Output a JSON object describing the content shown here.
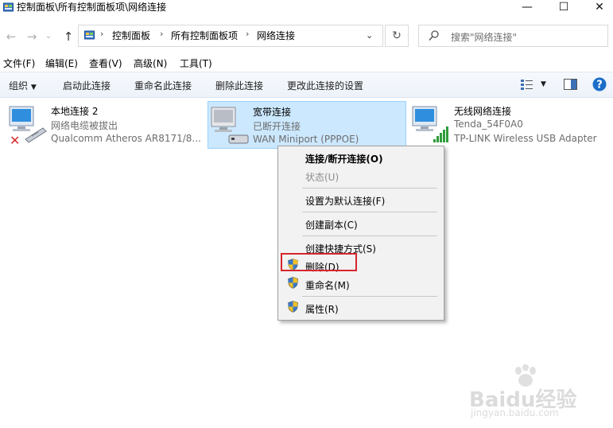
{
  "window": {
    "title": "控制面板\\所有控制面板项\\网络连接",
    "minimize_glyph": "—",
    "maximize_glyph": "☐",
    "close_glyph": "✕"
  },
  "address": {
    "crumbs": [
      "控制面板",
      "所有控制面板项",
      "网络连接"
    ],
    "search_placeholder": "搜索\"网络连接\""
  },
  "menubar": [
    "文件(F)",
    "编辑(E)",
    "查看(V)",
    "高级(N)",
    "工具(T)"
  ],
  "commandbar": {
    "organize": "组织",
    "items": [
      "启动此连接",
      "重命名此连接",
      "删除此连接",
      "更改此连接的设置"
    ]
  },
  "connections": [
    {
      "name": "本地连接 2",
      "status": "网络电缆被拔出",
      "device": "Qualcomm Atheros AR8171/8..."
    },
    {
      "name": "宽带连接",
      "status": "已断开连接",
      "device": "WAN Miniport (PPPOE)"
    },
    {
      "name": "无线网络连接",
      "status": "Tenda_54F0A0",
      "device": "TP-LINK Wireless USB Adapter"
    }
  ],
  "context_menu": {
    "items": [
      {
        "label": "连接/断开连接(O)",
        "bold": true
      },
      {
        "label": "状态(U)",
        "disabled": true
      },
      {
        "label": "设置为默认连接(F)"
      },
      {
        "label": "创建副本(C)"
      },
      {
        "label": "创建快捷方式(S)"
      },
      {
        "label": "删除(D)",
        "shield": true,
        "highlighted": true
      },
      {
        "label": "重命名(M)",
        "shield": true
      },
      {
        "label": "属性(R)",
        "shield": true
      }
    ]
  },
  "watermark": {
    "brand": "Baidu经验",
    "url": "jingyan.baidu.com"
  },
  "colors": {
    "selection": "#cce8ff",
    "highlight_box": "#d6262d",
    "accent": "#1c6ec9"
  }
}
